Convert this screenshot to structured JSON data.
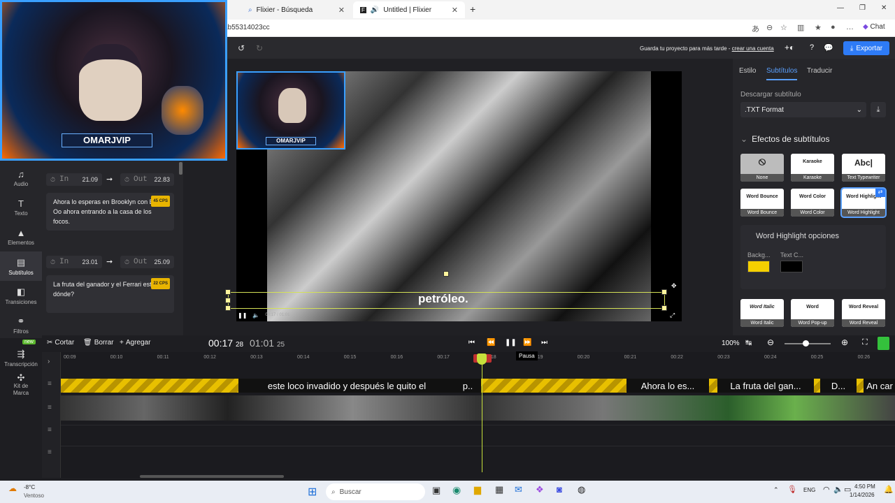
{
  "browser": {
    "tabs": [
      {
        "label": "Flixier - Búsqueda"
      },
      {
        "label": "Untitled | Flixier"
      }
    ],
    "url": "ab55314023cc",
    "chat_label": "Chat"
  },
  "app": {
    "save_prompt": "Guarda tu proyecto para más tarde - ",
    "create_account": "crear una cuenta",
    "export_label": "Exportar"
  },
  "sidebar": {
    "items": [
      {
        "label": "Audio",
        "icon": "music-note-icon"
      },
      {
        "label": "Texto",
        "icon": "text-icon"
      },
      {
        "label": "Elementos",
        "icon": "shapes-icon"
      },
      {
        "label": "Subtítulos",
        "icon": "subtitles-icon"
      },
      {
        "label": "Transiciones",
        "icon": "transition-icon"
      },
      {
        "label": "Filtros",
        "icon": "filters-icon"
      },
      {
        "label": "Transcripción",
        "icon": "transcription-icon",
        "badge": "new"
      },
      {
        "label": "Kit de Marca",
        "icon": "brand-kit-icon"
      }
    ]
  },
  "subtitle_cues": [
    {
      "in_label": "In",
      "in": "21.09",
      "out_label": "Out",
      "out": "22.83",
      "text": "Ahora lo esperas en Brooklyn con Baby Oo ahora entrando a la casa de los focos.",
      "cps": "45 CPS"
    },
    {
      "in_label": "In",
      "in": "23.01",
      "out_label": "Out",
      "out": "25.09",
      "text": "La fruta del ganador y el Ferrari está dónde?",
      "cps": "22 CPS"
    }
  ],
  "preview": {
    "subtitle_text": "petróleo.",
    "time_small": "00:17 / 01:01"
  },
  "right_panel": {
    "tabs": [
      "Estilo",
      "Subtítulos",
      "Traducir"
    ],
    "download_label": "Descargar subtítulo",
    "format": ".TXT Format",
    "effects_title": "Efectos de subtítulos",
    "effects": [
      {
        "sample": "",
        "name": "None"
      },
      {
        "sample": "Karaoke",
        "name": "Karaoke"
      },
      {
        "sample": "Abc|",
        "name": "Text Typewriter"
      },
      {
        "sample": "Word Bounce",
        "name": "Word Bounce"
      },
      {
        "sample": "Word Color",
        "name": "Word Color"
      },
      {
        "sample": "Word Highlight",
        "name": "Word Highlight"
      },
      {
        "sample": "Word Italic",
        "name": "Word Italic"
      },
      {
        "sample": "Word",
        "name": "Word Pop-up"
      },
      {
        "sample": "Word Reveal",
        "name": "Word Reveal"
      }
    ],
    "options_title": "Word Highlight opciones",
    "bg_label": "Backg...",
    "textcolor_label": "Text C...",
    "bg_color": "#f5d000",
    "text_color": "#000000"
  },
  "toolbar": {
    "cut": "Cortar",
    "delete": "Borrar",
    "add": "Agregar",
    "time_current": "00:17",
    "frame_current": "28",
    "time_total": "01:01",
    "frame_total": "25",
    "zoom": "100%",
    "tooltip": "Pausa"
  },
  "timeline": {
    "ticks": [
      "00:09",
      "00:10",
      "00:11",
      "00:12",
      "00:13",
      "00:14",
      "00:15",
      "00:16",
      "00:17",
      "00:18",
      "00:19",
      "00:20",
      "00:21",
      "00:22",
      "00:23",
      "00:24",
      "00:25",
      "00:26"
    ],
    "segments": [
      "este loco invadido y después le quito el",
      "p..",
      "Ahora lo es...",
      "La fruta del gan...",
      "D...",
      "An car"
    ]
  },
  "taskbar": {
    "temp": "-8°C",
    "weather": "Ventoso",
    "search": "Buscar",
    "lang": "ENG",
    "time": "4:50 PM",
    "date": "1/14/2026"
  },
  "overlay": {
    "streamer": "OMARJVIP"
  }
}
